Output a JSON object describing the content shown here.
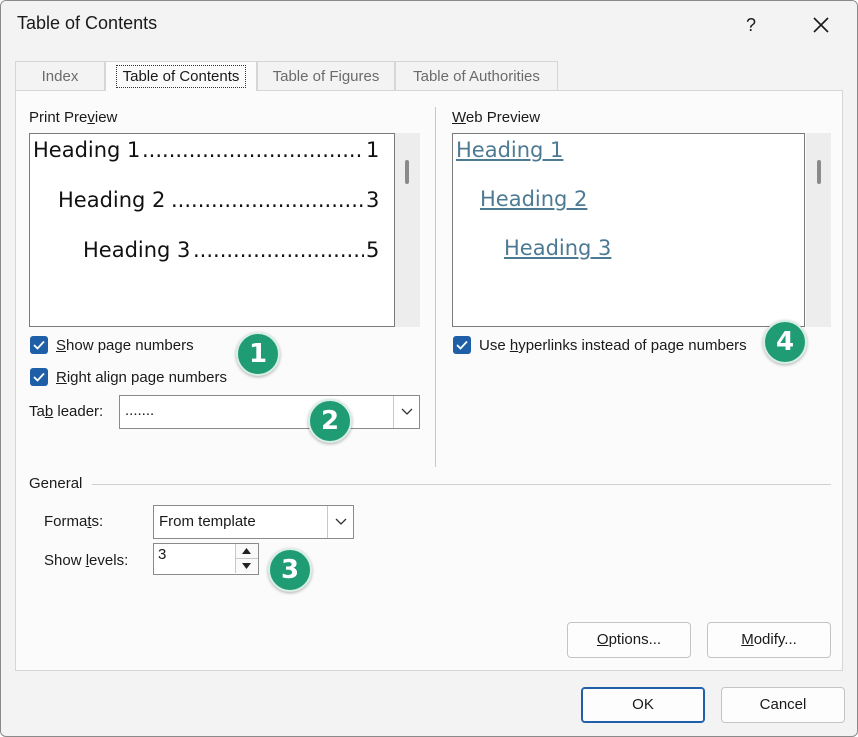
{
  "window": {
    "title": "Table of Contents",
    "help_label": "?"
  },
  "tabs": [
    {
      "label": "Index",
      "active": false
    },
    {
      "label": "Table of Contents",
      "active": true
    },
    {
      "label": "Table of Figures",
      "active": false
    },
    {
      "label": "Table of Authorities",
      "active": false
    }
  ],
  "print_preview": {
    "label_pre": "Print Pre",
    "label_u": "v",
    "label_post": "iew",
    "lines": [
      {
        "text": "Heading 1",
        "dots": "....................................................",
        "page": "1"
      },
      {
        "text": "Heading 2",
        "dots": "....................................................",
        "page": "3"
      },
      {
        "text": "Heading 3",
        "dots": "....................................................",
        "page": "5"
      }
    ]
  },
  "web_preview": {
    "label_u": "W",
    "label_post": "eb Preview",
    "links": [
      "Heading 1",
      "Heading 2",
      "Heading 3"
    ]
  },
  "options": {
    "show_page_numbers": {
      "u": "S",
      "rest": "how page numbers",
      "checked": true
    },
    "right_align": {
      "u": "R",
      "rest": "ight align page numbers",
      "checked": true
    },
    "use_hyperlinks": {
      "pre": "Use ",
      "u": "h",
      "rest": "yperlinks instead of page numbers",
      "checked": true
    }
  },
  "tab_leader": {
    "label_pre": "Ta",
    "label_u": "b",
    "label_post": " leader:",
    "value": "......."
  },
  "general": {
    "heading": "General",
    "formats_pre": "Forma",
    "formats_u": "t",
    "formats_post": "s:",
    "formats_value": "From template",
    "levels_pre": "Show ",
    "levels_u": "l",
    "levels_post": "evels:",
    "levels_value": "3"
  },
  "badges": [
    "1",
    "2",
    "3",
    "4"
  ],
  "buttons": {
    "options_u": "O",
    "options_rest": "ptions...",
    "modify_u": "M",
    "modify_rest": "odify...",
    "ok": "OK",
    "cancel": "Cancel"
  },
  "colors": {
    "accent": "#1f5fa8",
    "badge": "#1f9c74",
    "link": "#4d7a93"
  }
}
